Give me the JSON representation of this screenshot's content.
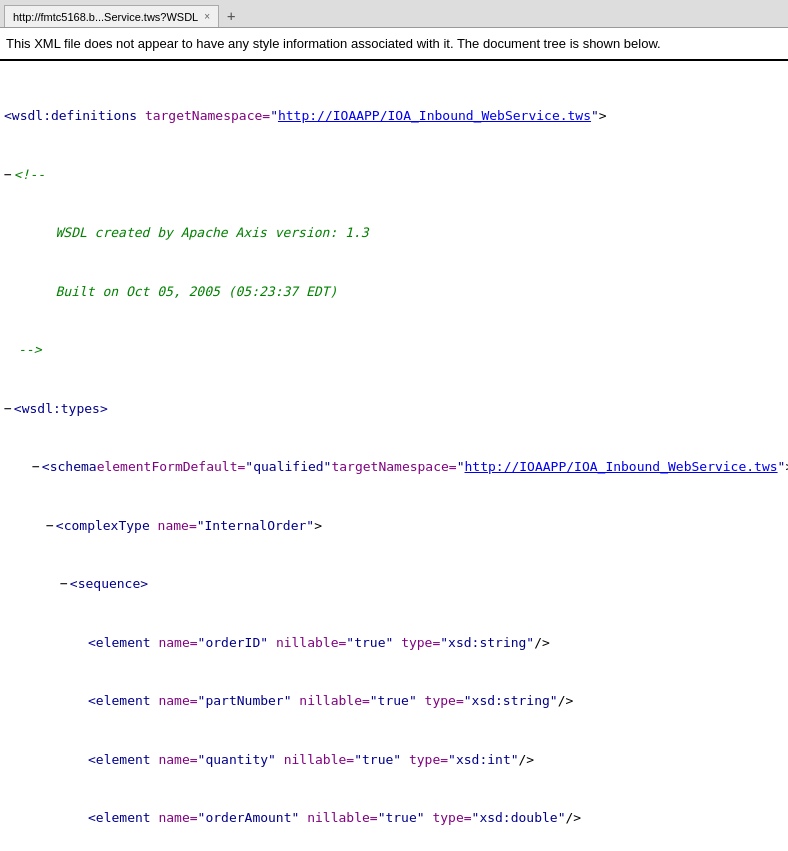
{
  "browser": {
    "tab_label": "http://fmtc5168.b...Service.tws?WSDL",
    "tab_close": "×",
    "tab_new": "+"
  },
  "info_bar": {
    "message": "This XML file does not appear to have any style information associated with it. The document tree is shown below."
  },
  "xml": {
    "targetNamespace_label": "targetNamespace=",
    "targetNamespace_value": "\"http://IOAAPP/IOA_Inbound_WebService.tws\"",
    "comment_line1": "WSDL created by Apache Axis version: 1.3",
    "comment_line2": "Built on Oct 05, 2005 (05:23:37 EDT)"
  }
}
